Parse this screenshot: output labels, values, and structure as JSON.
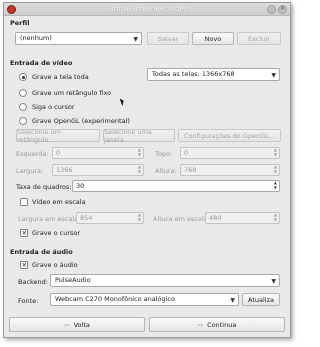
{
  "window": {
    "title": "SimpleScreenRecorder"
  },
  "profile": {
    "heading": "Perfil",
    "selected": "(nenhum)",
    "save_label": "Salvar",
    "new_label": "Novo",
    "delete_label": "Excluir"
  },
  "video": {
    "heading": "Entrada de vídeo",
    "options": [
      {
        "label": "Grave a tela toda",
        "checked": true
      },
      {
        "label": "Grave um retângulo fixo",
        "checked": false
      },
      {
        "label": "Siga o cursor",
        "checked": false
      },
      {
        "label": "Grave OpenGL (experimental)",
        "checked": false
      }
    ],
    "screen_select": "Todas as telas: 1366x768",
    "select_rect_label": "Selecione um retângulo...",
    "select_window_label": "Selecione uma janela...",
    "opengl_settings_label": "Configurações do OpenGL...",
    "left_label": "Esquerda:",
    "left_value": "0",
    "top_label": "Topo:",
    "top_value": "0",
    "width_label": "Largura:",
    "width_value": "1366",
    "height_label": "Altura:",
    "height_value": "768",
    "framerate_label": "Taxa de quadros:",
    "framerate_value": "30",
    "scale_label": "Vídeo em escala",
    "scaled_width_label": "Largura em escala:",
    "scaled_width_value": "854",
    "scaled_height_label": "Altura em escala:",
    "scaled_height_value": "480",
    "record_cursor_label": "Grave o cursor"
  },
  "audio": {
    "heading": "Entrada de áudio",
    "record_audio_label": "Grave o áudio",
    "backend_label": "Backend:",
    "backend_value": "PulseAudio",
    "source_label": "Fonte:",
    "source_value": "Webcam C270 Monofônico analógico",
    "refresh_label": "Atualiza"
  },
  "nav": {
    "back_label": "Volta",
    "continue_label": "Continua"
  }
}
